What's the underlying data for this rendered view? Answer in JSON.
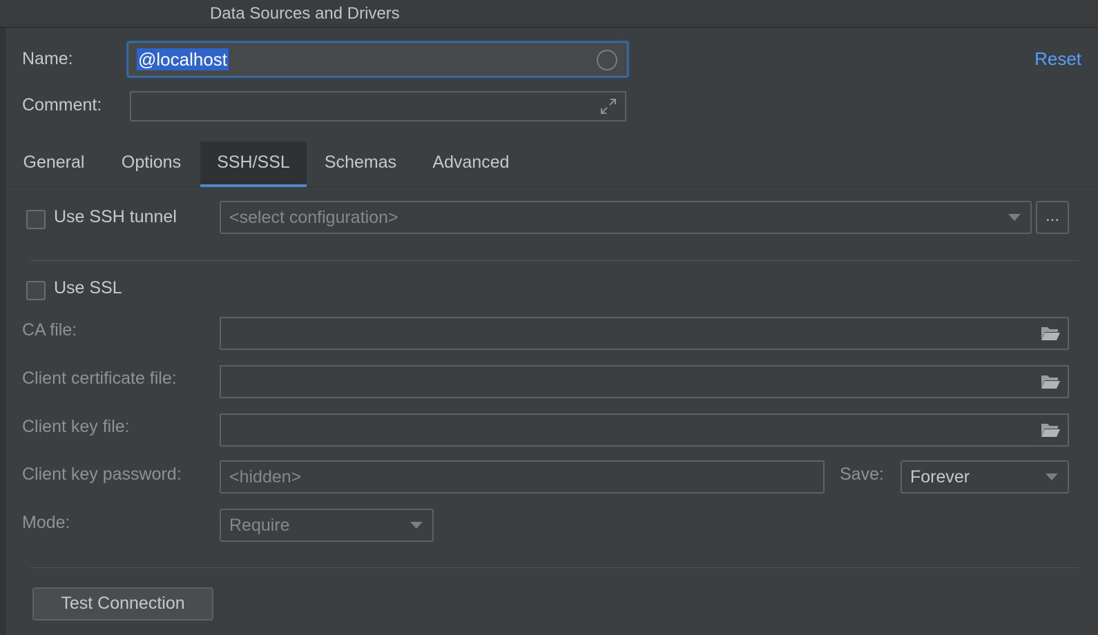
{
  "window": {
    "title": "Data Sources and Drivers"
  },
  "form": {
    "name_label": "Name:",
    "name_value": "@localhost",
    "comment_label": "Comment:",
    "comment_value": "",
    "reset_label": "Reset"
  },
  "tabs": [
    {
      "label": "General",
      "active": false
    },
    {
      "label": "Options",
      "active": false
    },
    {
      "label": "SSH/SSL",
      "active": true
    },
    {
      "label": "Schemas",
      "active": false
    },
    {
      "label": "Advanced",
      "active": false
    }
  ],
  "ssh": {
    "checkbox_label": "Use SSH tunnel",
    "checked": false,
    "config_placeholder": "<select configuration>",
    "more_button": "..."
  },
  "ssl": {
    "checkbox_label": "Use SSL",
    "checked": false,
    "ca_file_label": "CA file:",
    "ca_file_value": "",
    "client_cert_label": "Client certificate file:",
    "client_cert_value": "",
    "client_key_label": "Client key file:",
    "client_key_value": "",
    "key_password_label": "Client key password:",
    "key_password_placeholder": "<hidden>",
    "save_label": "Save:",
    "save_value": "Forever",
    "mode_label": "Mode:",
    "mode_value": "Require"
  },
  "footer": {
    "test_button": "Test Connection"
  },
  "colors": {
    "accent": "#589df6",
    "selection": "#2f65ca",
    "tab_underline": "#4a88c7",
    "background": "#3c3f41"
  },
  "icons": {
    "circle": "circle-icon",
    "expand": "expand-icon",
    "folder": "folder-icon",
    "dropdown": "chevron-down-icon"
  }
}
